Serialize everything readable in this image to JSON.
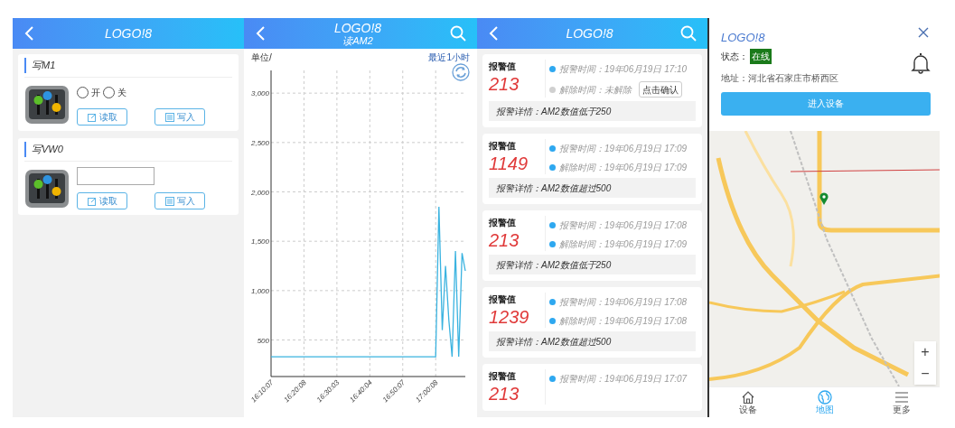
{
  "screen_write": {
    "title": "LOGO!8",
    "cards": [
      {
        "kind": "radio",
        "title": "写M1",
        "options": [
          {
            "label": "开",
            "selected": false
          },
          {
            "label": "关",
            "selected": false
          }
        ],
        "buttons": [
          "读取",
          "写入"
        ]
      },
      {
        "kind": "input",
        "title": "写VW0",
        "buttons": [
          "读取",
          "写入"
        ]
      }
    ]
  },
  "screen_chart": {
    "title": "LOGO!8",
    "subtitle": "读AM2",
    "unit_label": "单位/",
    "range_label": "最近1小时",
    "chart_data": {
      "type": "line",
      "grid": true,
      "ylim": [
        130,
        3230
      ],
      "categories": [
        "16:10:07",
        null,
        null,
        null,
        null,
        null,
        null,
        null,
        null,
        null,
        "16:20:08",
        null,
        null,
        null,
        null,
        null,
        null,
        null,
        null,
        null,
        "16:30:03",
        null,
        null,
        null,
        null,
        null,
        null,
        null,
        null,
        null,
        "16:40:04",
        null,
        null,
        null,
        null,
        null,
        null,
        null,
        null,
        null,
        "16:50:07",
        null,
        null,
        null,
        null,
        null,
        null,
        null,
        null,
        null,
        "17:00:08",
        null,
        null,
        null,
        null,
        null,
        null,
        null,
        null,
        null
      ],
      "yticks": [
        {
          "value": 500,
          "label": "500"
        },
        {
          "value": 1000,
          "label": "1,000"
        },
        {
          "value": 1500,
          "label": "1,500"
        },
        {
          "value": 2000,
          "label": "2,000"
        },
        {
          "value": 2500,
          "label": "2,500"
        },
        {
          "value": 3000,
          "label": "3,000"
        }
      ],
      "series": [
        {
          "color": "#3ab3e0",
          "values": [
            330,
            330,
            330,
            330,
            330,
            330,
            330,
            330,
            330,
            330,
            330,
            330,
            330,
            330,
            330,
            330,
            330,
            330,
            330,
            330,
            330,
            330,
            330,
            330,
            330,
            330,
            330,
            330,
            330,
            330,
            330,
            330,
            330,
            330,
            330,
            330,
            330,
            330,
            330,
            330,
            330,
            330,
            330,
            330,
            330,
            330,
            330,
            330,
            330,
            330,
            330,
            1850,
            600,
            1250,
            700,
            330,
            1400,
            330,
            1380,
            1200
          ]
        }
      ]
    }
  },
  "screen_alarms": {
    "title": "LOGO!8",
    "alarms": [
      {
        "title": "报警值",
        "value": "213",
        "alarm_time": "报警时间：19年06月19日 17:10",
        "release_time": "解除时间：未解除",
        "resolved": false,
        "confirm": "点击确认",
        "detail": "报警详情：AM2数值低于250"
      },
      {
        "title": "报警值",
        "value": "1149",
        "alarm_time": "报警时间：19年06月19日 17:09",
        "release_time": "解除时间：19年06月19日 17:09",
        "resolved": true,
        "detail": "报警详情：AM2数值超过500"
      },
      {
        "title": "报警值",
        "value": "213",
        "alarm_time": "报警时间：19年06月19日 17:08",
        "release_time": "解除时间：19年06月19日 17:09",
        "resolved": true,
        "detail": "报警详情：AM2数值低于250"
      },
      {
        "title": "报警值",
        "value": "1239",
        "alarm_time": "报警时间：19年06月19日 17:08",
        "release_time": "解除时间：19年06月19日 17:08",
        "resolved": true,
        "detail": "报警详情：AM2数值超过500"
      },
      {
        "title": "报警值",
        "value": "213",
        "alarm_time": "报警时间：19年06月19日 17:07"
      }
    ]
  },
  "screen_map": {
    "device": {
      "name": "LOGO!8",
      "status_label": "状态：",
      "status": "在线",
      "address": "地址：河北省石家庄市桥西区",
      "enter_button": "进入设备"
    },
    "zoom_in": "+",
    "zoom_out": "−",
    "nav": [
      {
        "label": "设备",
        "selected": false
      },
      {
        "label": "地图",
        "selected": true
      },
      {
        "label": "更多",
        "selected": false
      }
    ]
  }
}
